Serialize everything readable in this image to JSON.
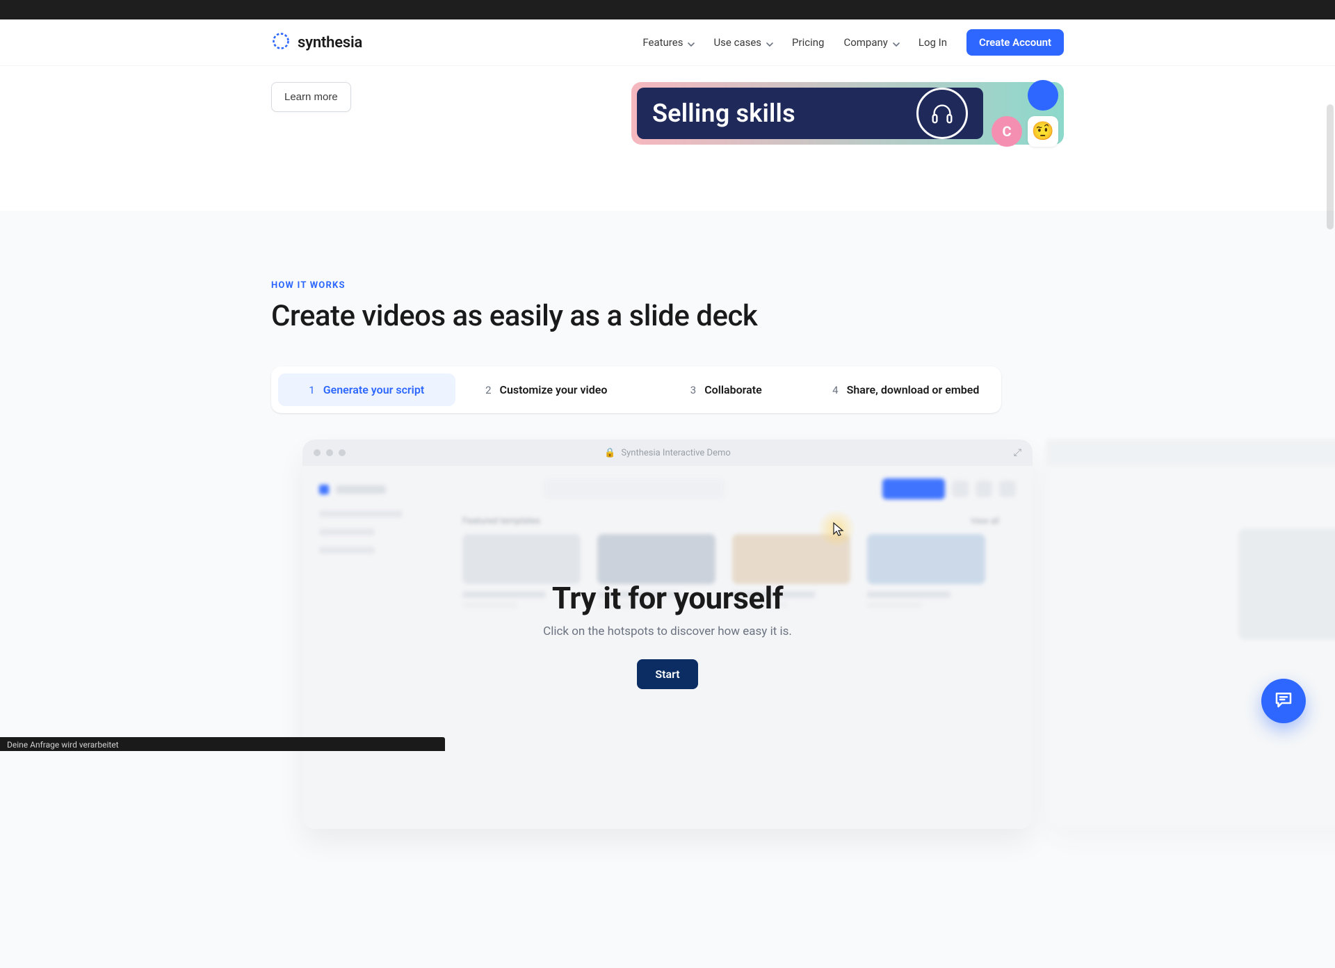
{
  "brand": {
    "name": "synthesia"
  },
  "nav": {
    "features": "Features",
    "usecases": "Use cases",
    "pricing": "Pricing",
    "company": "Company",
    "login": "Log In",
    "cta": "Create Account"
  },
  "hero": {
    "learn_more": "Learn more",
    "selling_skills": "Selling skills",
    "avatar_letter": "C",
    "emoji": "🤨"
  },
  "how": {
    "eyebrow": "HOW IT WORKS",
    "headline": "Create videos as easily as a slide deck",
    "steps": [
      {
        "num": "1",
        "label": "Generate your script"
      },
      {
        "num": "2",
        "label": "Customize your video"
      },
      {
        "num": "3",
        "label": "Collaborate"
      },
      {
        "num": "4",
        "label": "Share, download or embed"
      }
    ]
  },
  "demo": {
    "title": "Synthesia Interactive Demo",
    "featured": "Featured templates",
    "viewall": "View all",
    "overlay_title": "Try it for yourself",
    "overlay_sub": "Click on the hotspots to discover how easy it is.",
    "start": "Start"
  },
  "status": "Deine Anfrage wird verarbeitet"
}
